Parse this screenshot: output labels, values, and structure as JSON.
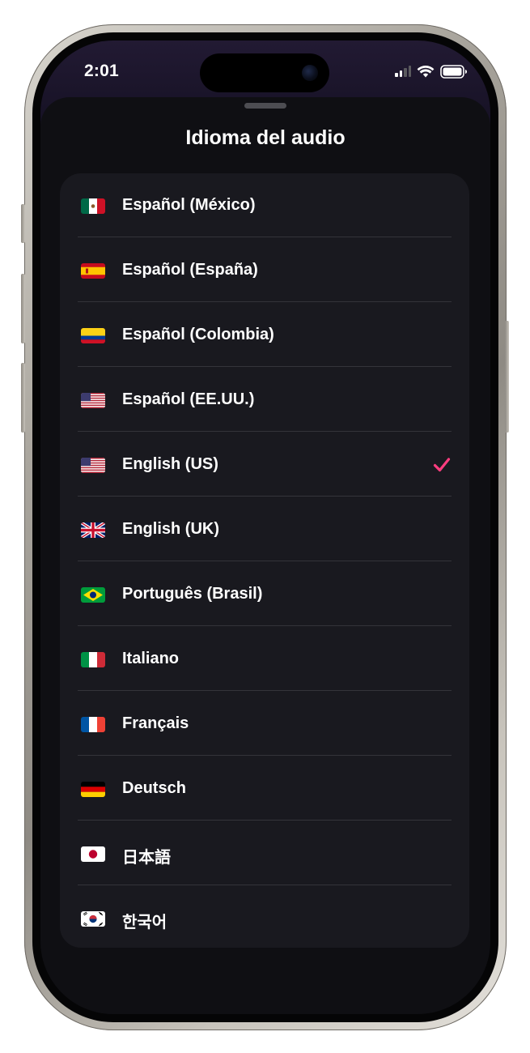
{
  "status_bar": {
    "time": "2:01",
    "icons": [
      "cellular-signal-icon",
      "wifi-icon",
      "battery-icon"
    ]
  },
  "sheet": {
    "title": "Idioma del audio"
  },
  "colors": {
    "accent_check": "#ff3d7f",
    "sheet_bg": "#0f0f13",
    "card_bg": "#19191f",
    "divider": "#34343a",
    "text": "#ffffff"
  },
  "languages": [
    {
      "label": "Español (México)",
      "flag": "mexico-flag-icon",
      "selected": false
    },
    {
      "label": "Español (España)",
      "flag": "spain-flag-icon",
      "selected": false
    },
    {
      "label": "Español (Colombia)",
      "flag": "colombia-flag-icon",
      "selected": false
    },
    {
      "label": "Español (EE.UU.)",
      "flag": "usa-flag-icon",
      "selected": false
    },
    {
      "label": "English (US)",
      "flag": "usa-flag-icon",
      "selected": true
    },
    {
      "label": "English (UK)",
      "flag": "uk-flag-icon",
      "selected": false
    },
    {
      "label": "Português (Brasil)",
      "flag": "brazil-flag-icon",
      "selected": false
    },
    {
      "label": "Italiano",
      "flag": "italy-flag-icon",
      "selected": false
    },
    {
      "label": "Français",
      "flag": "france-flag-icon",
      "selected": false
    },
    {
      "label": "Deutsch",
      "flag": "germany-flag-icon",
      "selected": false
    },
    {
      "label": "日本語",
      "flag": "japan-flag-icon",
      "selected": false
    },
    {
      "label": "한국어",
      "flag": "south-korea-flag-icon",
      "selected": false
    }
  ]
}
